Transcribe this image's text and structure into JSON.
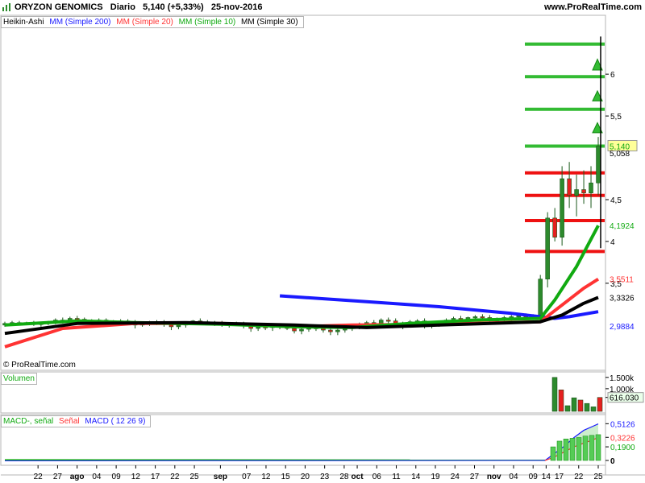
{
  "header": {
    "symbol": "ORYZON GENOMICS",
    "period": "Diario",
    "price": "5,140",
    "change": "(+5,33%)",
    "date": "25-nov-2016",
    "site": "www.ProRealTime.com",
    "icon": "bar-chart-icon"
  },
  "price_legend": {
    "heikin": "Heikin-Ashi",
    "mm200": "MM (Simple 200)",
    "mm20": "MM (Simple 20)",
    "mm10": "MM (Simple 10)",
    "mm30": "MM (Simple 30)"
  },
  "volume_legend": "Volumen",
  "macd_legend": {
    "macd_signal": "MACD-, señal",
    "signal": "Señal",
    "macd": "MACD ( 12 26 9)"
  },
  "copyright": "© ProRealTime.com",
  "colors": {
    "bull": "#2d8a2d",
    "bear": "#e52020",
    "mm200": "#1a1aff",
    "mm20": "#ff3333",
    "mm10": "#11aa11",
    "mm30": "#000000",
    "hline_green": "#33bb33",
    "hline_red": "#ee1111"
  },
  "chart_data": {
    "type": "candlestick",
    "candles": [
      [
        3.0,
        3.04,
        2.98,
        3.02
      ],
      [
        3.02,
        3.05,
        2.99,
        3.03
      ],
      [
        3.03,
        3.05,
        3.0,
        3.02
      ],
      [
        3.02,
        3.04,
        3.0,
        3.03
      ],
      [
        3.02,
        3.05,
        2.99,
        3.01
      ],
      [
        3.01,
        3.04,
        2.98,
        3.02
      ],
      [
        3.02,
        3.05,
        3.0,
        3.04
      ],
      [
        3.04,
        3.08,
        3.01,
        3.06
      ],
      [
        3.06,
        3.09,
        3.02,
        3.05
      ],
      [
        3.05,
        3.1,
        3.03,
        3.08
      ],
      [
        3.08,
        3.11,
        3.05,
        3.07
      ],
      [
        3.07,
        3.09,
        3.03,
        3.04
      ],
      [
        3.04,
        3.07,
        3.01,
        3.05
      ],
      [
        3.05,
        3.08,
        3.02,
        3.06
      ],
      [
        3.06,
        3.08,
        3.02,
        3.03
      ],
      [
        3.03,
        3.06,
        2.99,
        3.04
      ],
      [
        3.04,
        3.07,
        3.01,
        3.05
      ],
      [
        3.05,
        3.07,
        3.02,
        3.04
      ],
      [
        3.04,
        3.06,
        2.96,
        3.0
      ],
      [
        3.0,
        3.04,
        2.98,
        3.02
      ],
      [
        3.02,
        3.05,
        2.99,
        3.03
      ],
      [
        3.03,
        3.06,
        3.0,
        3.04
      ],
      [
        3.04,
        3.06,
        2.98,
        3.01
      ],
      [
        3.01,
        3.03,
        2.94,
        2.98
      ],
      [
        2.98,
        3.02,
        2.95,
        3.0
      ],
      [
        3.0,
        3.04,
        2.97,
        3.03
      ],
      [
        3.03,
        3.06,
        3.0,
        3.05
      ],
      [
        3.05,
        3.08,
        3.02,
        3.04
      ],
      [
        3.04,
        3.06,
        3.0,
        3.02
      ],
      [
        3.02,
        3.05,
        2.99,
        3.03
      ],
      [
        3.03,
        3.05,
        2.98,
        3.0
      ],
      [
        3.0,
        3.03,
        2.97,
        3.01
      ],
      [
        3.01,
        3.04,
        2.99,
        3.02
      ],
      [
        3.02,
        3.04,
        2.96,
        2.99
      ],
      [
        2.99,
        3.02,
        2.92,
        2.96
      ],
      [
        2.96,
        3.0,
        2.93,
        2.98
      ],
      [
        2.98,
        3.01,
        2.94,
        2.97
      ],
      [
        2.97,
        3.0,
        2.93,
        2.99
      ],
      [
        2.99,
        3.02,
        2.95,
        2.98
      ],
      [
        2.98,
        3.01,
        2.94,
        2.96
      ],
      [
        2.96,
        2.99,
        2.9,
        2.93
      ],
      [
        2.93,
        2.97,
        2.89,
        2.95
      ],
      [
        2.95,
        2.99,
        2.92,
        2.97
      ],
      [
        2.97,
        3.0,
        2.93,
        2.96
      ],
      [
        2.96,
        2.99,
        2.91,
        2.94
      ],
      [
        2.94,
        2.97,
        2.88,
        2.92
      ],
      [
        2.92,
        2.96,
        2.88,
        2.94
      ],
      [
        2.94,
        2.98,
        2.91,
        2.96
      ],
      [
        2.96,
        3.0,
        2.93,
        2.98
      ],
      [
        2.98,
        3.03,
        2.95,
        3.01
      ],
      [
        3.01,
        3.05,
        2.98,
        3.03
      ],
      [
        3.03,
        3.06,
        2.99,
        3.02
      ],
      [
        3.02,
        3.08,
        3.0,
        3.06
      ],
      [
        3.06,
        3.09,
        3.02,
        3.05
      ],
      [
        3.05,
        3.08,
        2.98,
        3.0
      ],
      [
        3.0,
        3.04,
        2.95,
        3.02
      ],
      [
        3.02,
        3.06,
        2.99,
        3.04
      ],
      [
        3.04,
        3.07,
        3.0,
        3.05
      ],
      [
        3.05,
        3.08,
        2.96,
        2.99
      ],
      [
        2.99,
        3.03,
        2.96,
        3.01
      ],
      [
        3.01,
        3.05,
        2.98,
        3.04
      ],
      [
        3.04,
        3.08,
        3.01,
        3.06
      ],
      [
        3.06,
        3.1,
        3.03,
        3.08
      ],
      [
        3.08,
        3.11,
        3.04,
        3.07
      ],
      [
        3.07,
        3.1,
        3.03,
        3.09
      ],
      [
        3.09,
        3.12,
        3.05,
        3.1
      ],
      [
        3.1,
        3.13,
        3.06,
        3.09
      ],
      [
        3.09,
        3.12,
        3.02,
        3.05
      ],
      [
        3.05,
        3.09,
        3.02,
        3.07
      ],
      [
        3.07,
        3.11,
        3.04,
        3.09
      ],
      [
        3.09,
        3.12,
        3.05,
        3.1
      ],
      [
        3.1,
        3.13,
        3.06,
        3.11
      ],
      [
        3.11,
        3.14,
        3.07,
        3.1
      ],
      [
        3.1,
        3.13,
        3.06,
        3.12
      ],
      [
        3.12,
        3.6,
        3.1,
        3.55
      ],
      [
        3.55,
        4.35,
        3.45,
        4.28
      ],
      [
        4.28,
        4.4,
        4.0,
        4.05
      ],
      [
        4.05,
        4.9,
        3.95,
        4.75
      ],
      [
        4.75,
        4.95,
        4.4,
        4.55
      ],
      [
        4.55,
        4.8,
        4.3,
        4.62
      ],
      [
        4.62,
        4.85,
        4.45,
        4.58
      ],
      [
        4.58,
        4.9,
        4.4,
        4.7
      ],
      [
        4.7,
        5.25,
        4.55,
        5.14
      ]
    ],
    "mm200": [
      [
        38,
        3.35
      ],
      [
        50,
        3.28
      ],
      [
        60,
        3.22
      ],
      [
        70,
        3.14
      ],
      [
        76,
        3.08
      ],
      [
        78,
        3.1
      ],
      [
        82,
        3.16
      ]
    ],
    "mm20": [
      [
        0,
        2.74
      ],
      [
        8,
        2.96
      ],
      [
        18,
        3.02
      ],
      [
        30,
        3.02
      ],
      [
        40,
        2.98
      ],
      [
        48,
        3.0
      ],
      [
        60,
        3.01
      ],
      [
        74,
        3.04
      ],
      [
        77,
        3.24
      ],
      [
        80,
        3.44
      ],
      [
        82,
        3.55
      ]
    ],
    "mm10": [
      [
        0,
        3.0
      ],
      [
        10,
        3.05
      ],
      [
        18,
        3.03
      ],
      [
        30,
        3.01
      ],
      [
        40,
        2.98
      ],
      [
        48,
        2.97
      ],
      [
        56,
        3.02
      ],
      [
        65,
        3.06
      ],
      [
        74,
        3.08
      ],
      [
        76,
        3.3
      ],
      [
        79,
        3.7
      ],
      [
        82,
        4.19
      ]
    ],
    "mm30": [
      [
        0,
        2.9
      ],
      [
        10,
        3.02
      ],
      [
        25,
        3.03
      ],
      [
        40,
        3.0
      ],
      [
        50,
        2.97
      ],
      [
        60,
        3.0
      ],
      [
        74,
        3.04
      ],
      [
        77,
        3.12
      ],
      [
        80,
        3.26
      ],
      [
        82,
        3.33
      ]
    ],
    "hlines": [
      {
        "value": 6.36,
        "kind": "green"
      },
      {
        "value": 5.97,
        "kind": "green"
      },
      {
        "value": 5.58,
        "kind": "green"
      },
      {
        "value": 5.14,
        "kind": "green"
      },
      {
        "value": 4.82,
        "kind": "red"
      },
      {
        "value": 4.55,
        "kind": "red"
      },
      {
        "value": 4.25,
        "kind": "red"
      },
      {
        "value": 3.88,
        "kind": "red"
      }
    ],
    "price_ticks": [
      "6",
      "5,5",
      "4,5",
      "4",
      "3,5"
    ],
    "price_tick_values": [
      6,
      5.5,
      4.5,
      4,
      3.5
    ],
    "price_labels": [
      {
        "text": "5,140",
        "value": 5.14,
        "color": "#11aa11",
        "box": true
      },
      {
        "text": "5,058",
        "value": 5.058,
        "color": "#000000",
        "box": false
      },
      {
        "text": "4,1924",
        "value": 4.1924,
        "color": "#11aa11",
        "box": false
      },
      {
        "text": "3,5511",
        "value": 3.5511,
        "color": "#ff3333",
        "box": false
      },
      {
        "text": "3,3326",
        "value": 3.3326,
        "color": "#000000",
        "box": false
      },
      {
        "text": "2,9884",
        "value": 2.9884,
        "color": "#1a1aff",
        "box": false
      }
    ],
    "volume": [
      0,
      0,
      0,
      0,
      0,
      0,
      0,
      0,
      0,
      0,
      0,
      0,
      0,
      0,
      0,
      0,
      0,
      0,
      0,
      0,
      0,
      0,
      0,
      0,
      0,
      0,
      0,
      0,
      0,
      0,
      0,
      0,
      0,
      0,
      0,
      0,
      0,
      0,
      0,
      0,
      0,
      0,
      0,
      0,
      0,
      0,
      0,
      0,
      0,
      0,
      0,
      0,
      0,
      0,
      0,
      0,
      0,
      0,
      0,
      0,
      0,
      0,
      0,
      0,
      0,
      0,
      0,
      0,
      0,
      0,
      0,
      0,
      0,
      0,
      0,
      1.5,
      0.95,
      0.25,
      0.6,
      0.5,
      0.35,
      0.2,
      0.616
    ],
    "volume_ticks": [
      "1.500k",
      "1.000k",
      "616.030"
    ],
    "macd_hist": [
      0.19,
      0.27,
      0.3,
      0.31,
      0.32,
      0.34,
      0.35,
      0.36
    ],
    "macd_ticks": [
      "0,5126",
      "0,3226",
      "0,1900",
      "0"
    ],
    "x_labels": [
      {
        "text": "22",
        "i": 2
      },
      {
        "text": "27",
        "i": 5
      },
      {
        "text": "ago",
        "i": 8,
        "bold": true
      },
      {
        "text": "04",
        "i": 11
      },
      {
        "text": "09",
        "i": 14
      },
      {
        "text": "12",
        "i": 17
      },
      {
        "text": "17",
        "i": 20
      },
      {
        "text": "22",
        "i": 23
      },
      {
        "text": "25",
        "i": 26
      },
      {
        "text": "sep",
        "i": 30,
        "bold": true
      },
      {
        "text": "07",
        "i": 34
      },
      {
        "text": "12",
        "i": 37
      },
      {
        "text": "15",
        "i": 40
      },
      {
        "text": "20",
        "i": 43
      },
      {
        "text": "23",
        "i": 46
      },
      {
        "text": "28",
        "i": 49
      },
      {
        "text": "oct",
        "i": 51,
        "bold": true
      },
      {
        "text": "06",
        "i": 54
      },
      {
        "text": "11",
        "i": 57
      },
      {
        "text": "14",
        "i": 60
      },
      {
        "text": "19",
        "i": 63
      },
      {
        "text": "24",
        "i": 66
      },
      {
        "text": "27",
        "i": 69
      },
      {
        "text": "nov",
        "i": 72,
        "bold": true
      },
      {
        "text": "04",
        "i": 75
      },
      {
        "text": "09",
        "i": 78
      },
      {
        "text": "14",
        "i": 80
      },
      {
        "text": "17",
        "i": 82
      },
      {
        "text": "22",
        "i": 85
      },
      {
        "text": "25",
        "i": 88
      }
    ]
  }
}
